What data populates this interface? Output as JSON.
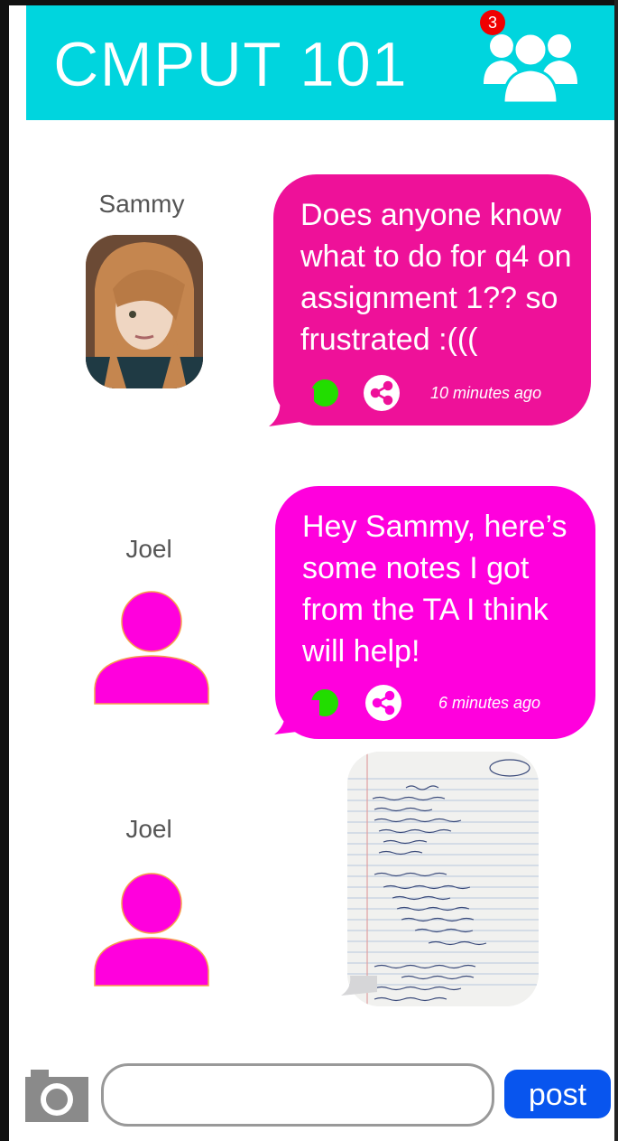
{
  "header": {
    "title": "CMPUT 101",
    "notification_count": "3",
    "icon": "group-people-icon",
    "background_color": "#00d5de"
  },
  "messages": [
    {
      "author": "Sammy",
      "text": "Does anyone know what to do for q4 on assignment 1?? so frustrated :(((",
      "time": "10 minutes ago",
      "bubble_color": "#ee1199"
    },
    {
      "author": "Joel",
      "text": "Hey Sammy, here’s some notes I got from the TA I think will help!",
      "time": "6 minutes ago",
      "bubble_color": "#ff00dd"
    },
    {
      "author": "Joel",
      "attachment": "handwritten-notes-image"
    }
  ],
  "composer": {
    "input_value": "",
    "post_label": "post",
    "camera_icon": "camera-icon"
  },
  "colors": {
    "online": "#22dd00",
    "post_button": "#0855ee",
    "avatar_generic": "#ff00dd"
  }
}
